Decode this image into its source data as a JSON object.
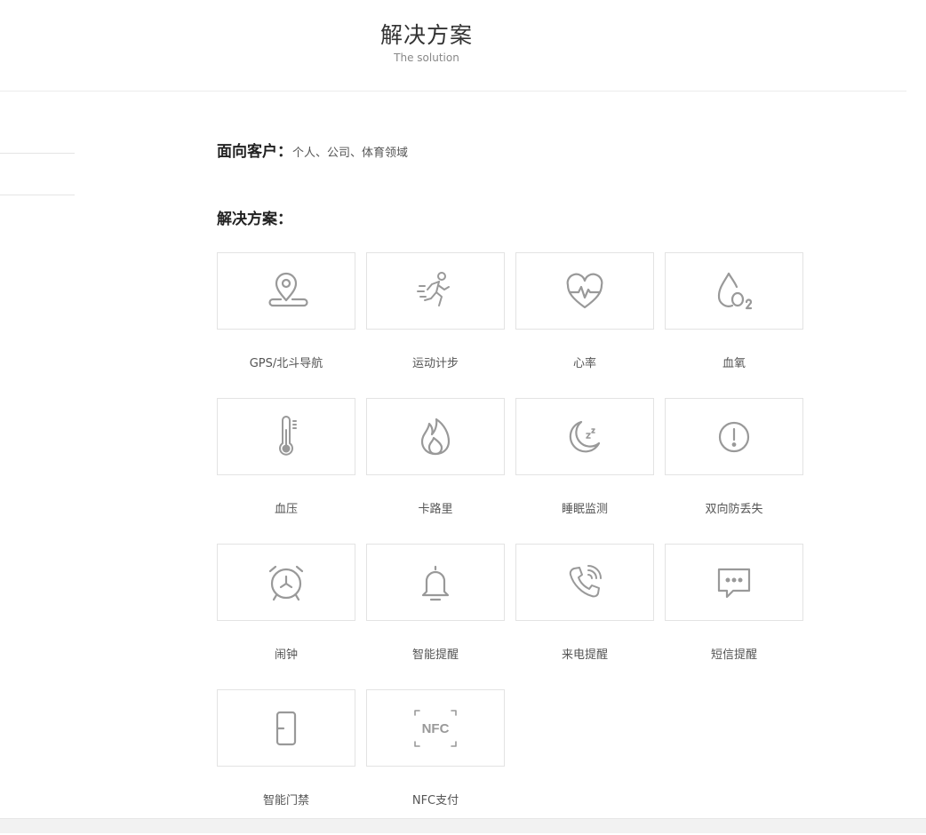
{
  "header": {
    "title": "解决方案",
    "subtitle": "The solution"
  },
  "customers": {
    "label": "面向客户：",
    "value": "个人、公司、体育领域"
  },
  "solutions": {
    "label": "解决方案："
  },
  "features": [
    {
      "label": "GPS/北斗导航",
      "icon": "location-pin-icon"
    },
    {
      "label": "运动计步",
      "icon": "running-man-icon"
    },
    {
      "label": "心率",
      "icon": "heart-rate-icon"
    },
    {
      "label": "血氧",
      "icon": "oxygen-drop-icon"
    },
    {
      "label": "血压",
      "icon": "thermometer-icon"
    },
    {
      "label": "卡路里",
      "icon": "flame-icon"
    },
    {
      "label": "睡眠监测",
      "icon": "moon-sleep-icon"
    },
    {
      "label": "双向防丢失",
      "icon": "alert-circle-icon"
    },
    {
      "label": "闹钟",
      "icon": "alarm-clock-icon"
    },
    {
      "label": "智能提醒",
      "icon": "bell-icon"
    },
    {
      "label": "来电提醒",
      "icon": "phone-ring-icon"
    },
    {
      "label": "短信提醒",
      "icon": "message-bubble-icon"
    },
    {
      "label": "智能门禁",
      "icon": "door-icon"
    },
    {
      "label": "NFC支付",
      "icon": "nfc-icon",
      "icon_text": "NFC"
    }
  ],
  "colors": {
    "icon": "#999999",
    "border": "#e3e3e3",
    "text": "#555555"
  }
}
